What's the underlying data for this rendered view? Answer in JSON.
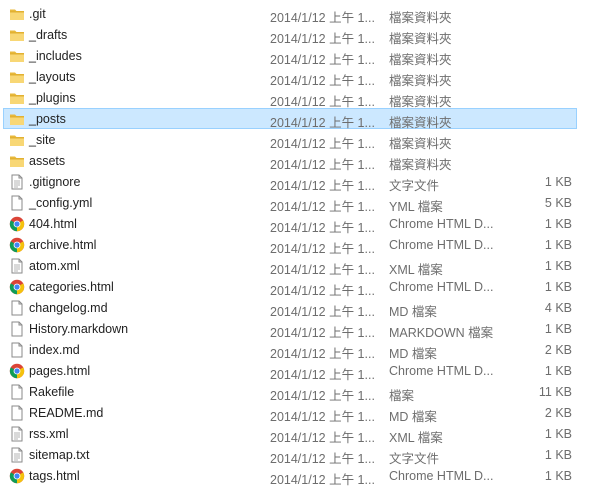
{
  "files": [
    {
      "name": ".git",
      "date": "2014/1/12 上午 1...",
      "type": "檔案資料夾",
      "size": "",
      "icon": "folder-icon"
    },
    {
      "name": "_drafts",
      "date": "2014/1/12 上午 1...",
      "type": "檔案資料夾",
      "size": "",
      "icon": "folder-icon"
    },
    {
      "name": "_includes",
      "date": "2014/1/12 上午 1...",
      "type": "檔案資料夾",
      "size": "",
      "icon": "folder-icon"
    },
    {
      "name": "_layouts",
      "date": "2014/1/12 上午 1...",
      "type": "檔案資料夾",
      "size": "",
      "icon": "folder-icon"
    },
    {
      "name": "_plugins",
      "date": "2014/1/12 上午 1...",
      "type": "檔案資料夾",
      "size": "",
      "icon": "folder-icon"
    },
    {
      "name": "_posts",
      "date": "2014/1/12 上午 1...",
      "type": "檔案資料夾",
      "size": "",
      "icon": "folder-icon",
      "selected": true
    },
    {
      "name": "_site",
      "date": "2014/1/12 上午 1...",
      "type": "檔案資料夾",
      "size": "",
      "icon": "folder-icon"
    },
    {
      "name": "assets",
      "date": "2014/1/12 上午 1...",
      "type": "檔案資料夾",
      "size": "",
      "icon": "folder-icon"
    },
    {
      "name": ".gitignore",
      "date": "2014/1/12 上午 1...",
      "type": "文字文件",
      "size": "1 KB",
      "icon": "text-file-icon"
    },
    {
      "name": "_config.yml",
      "date": "2014/1/12 上午 1...",
      "type": "YML 檔案",
      "size": "5 KB",
      "icon": "file-icon"
    },
    {
      "name": "404.html",
      "date": "2014/1/12 上午 1...",
      "type": "Chrome HTML D...",
      "size": "1 KB",
      "icon": "chrome-icon"
    },
    {
      "name": "archive.html",
      "date": "2014/1/12 上午 1...",
      "type": "Chrome HTML D...",
      "size": "1 KB",
      "icon": "chrome-icon"
    },
    {
      "name": "atom.xml",
      "date": "2014/1/12 上午 1...",
      "type": "XML 檔案",
      "size": "1 KB",
      "icon": "text-file-icon"
    },
    {
      "name": "categories.html",
      "date": "2014/1/12 上午 1...",
      "type": "Chrome HTML D...",
      "size": "1 KB",
      "icon": "chrome-icon"
    },
    {
      "name": "changelog.md",
      "date": "2014/1/12 上午 1...",
      "type": "MD 檔案",
      "size": "4 KB",
      "icon": "file-icon"
    },
    {
      "name": "History.markdown",
      "date": "2014/1/12 上午 1...",
      "type": "MARKDOWN 檔案",
      "size": "1 KB",
      "icon": "file-icon"
    },
    {
      "name": "index.md",
      "date": "2014/1/12 上午 1...",
      "type": "MD 檔案",
      "size": "2 KB",
      "icon": "file-icon"
    },
    {
      "name": "pages.html",
      "date": "2014/1/12 上午 1...",
      "type": "Chrome HTML D...",
      "size": "1 KB",
      "icon": "chrome-icon"
    },
    {
      "name": "Rakefile",
      "date": "2014/1/12 上午 1...",
      "type": "檔案",
      "size": "11 KB",
      "icon": "file-icon"
    },
    {
      "name": "README.md",
      "date": "2014/1/12 上午 1...",
      "type": "MD 檔案",
      "size": "2 KB",
      "icon": "file-icon"
    },
    {
      "name": "rss.xml",
      "date": "2014/1/12 上午 1...",
      "type": "XML 檔案",
      "size": "1 KB",
      "icon": "text-file-icon"
    },
    {
      "name": "sitemap.txt",
      "date": "2014/1/12 上午 1...",
      "type": "文字文件",
      "size": "1 KB",
      "icon": "text-file-icon"
    },
    {
      "name": "tags.html",
      "date": "2014/1/12 上午 1...",
      "type": "Chrome HTML D...",
      "size": "1 KB",
      "icon": "chrome-icon"
    }
  ]
}
